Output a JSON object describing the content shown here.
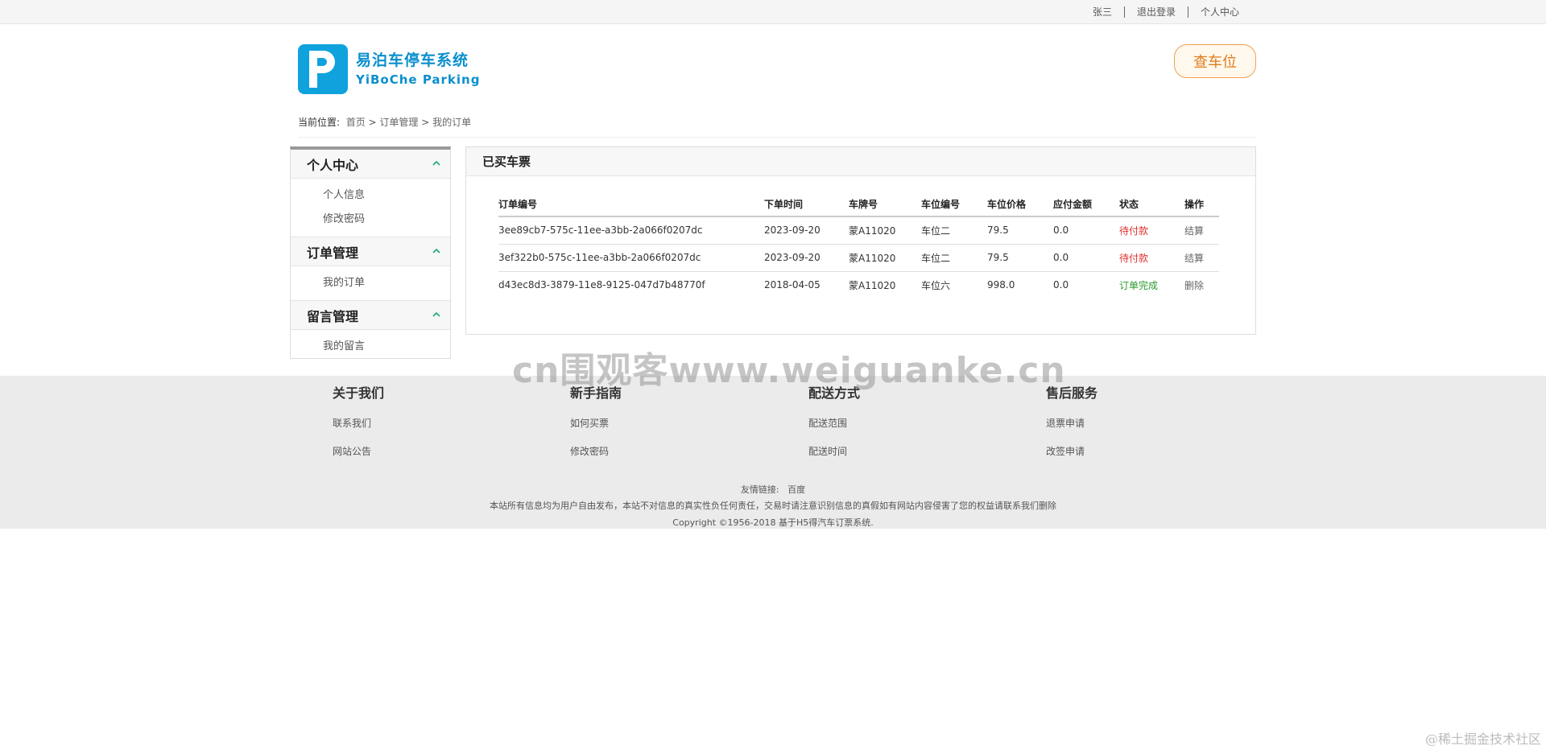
{
  "topbar": {
    "user": "张三",
    "logout": "退出登录",
    "profile": "个人中心"
  },
  "brand": {
    "name_cn": "易泊车停车系统",
    "name_en": "YiBoChe  Parking",
    "accent": "#0fa2dd"
  },
  "header": {
    "search_button": "查车位"
  },
  "breadcrumb": {
    "label": "当前位置:",
    "items": [
      "首页",
      "订单管理",
      "我的订单"
    ],
    "sep": ">"
  },
  "sidebar": {
    "sections": [
      {
        "title": "个人中心",
        "items": [
          "个人信息",
          "修改密码"
        ]
      },
      {
        "title": "订单管理",
        "items": [
          "我的订单"
        ]
      },
      {
        "title": "留言管理",
        "items": [
          "我的留言"
        ]
      }
    ]
  },
  "panel": {
    "title": "已买车票",
    "columns": [
      "订单编号",
      "下单时间",
      "车牌号",
      "车位编号",
      "车位价格",
      "应付金额",
      "状态",
      "操作"
    ],
    "rows": [
      [
        "3ee89cb7-575c-11ee-a3bb-2a066f0207dc",
        "2023-09-20",
        "蒙A11020",
        "车位二",
        "79.5",
        "0.0",
        "待付款",
        "结算"
      ],
      [
        "3ef322b0-575c-11ee-a3bb-2a066f0207dc",
        "2023-09-20",
        "蒙A11020",
        "车位二",
        "79.5",
        "0.0",
        "待付款",
        "结算"
      ],
      [
        "d43ec8d3-3879-11e8-9125-047d7b48770f",
        "2018-04-05",
        "蒙A11020",
        "车位六",
        "998.0",
        "0.0",
        "订单完成",
        "删除"
      ]
    ],
    "status_colors": {
      "待付款": "#e03030",
      "订单完成": "#2a9a2a"
    }
  },
  "footer": {
    "columns": [
      {
        "title": "关于我们",
        "items": [
          "联系我们",
          "网站公告"
        ]
      },
      {
        "title": "新手指南",
        "items": [
          "如何买票",
          "修改密码"
        ]
      },
      {
        "title": "配送方式",
        "items": [
          "配送范围",
          "配送时间"
        ]
      },
      {
        "title": "售后服务",
        "items": [
          "退票申请",
          "改签申请"
        ]
      }
    ],
    "friend_label": "友情链接:",
    "friend_link": "百度",
    "disclaimer": "本站所有信息均为用户自由发布，本站不对信息的真实性负任何责任，交易时请注意识别信息的真假如有网站内容侵害了您的权益请联系我们删除",
    "copyright": "Copyright ©1956-2018 基于H5得汽车订票系统."
  },
  "watermark": "cn围观客www.weiguanke.cn",
  "credit": "@稀土掘金技术社区"
}
